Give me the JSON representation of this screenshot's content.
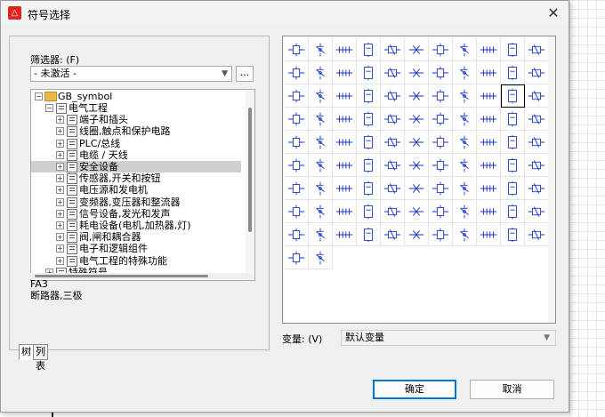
{
  "window": {
    "title": "符号选择",
    "app_icon": "app-logo-icon",
    "close_glyph": "✕"
  },
  "filter": {
    "label": "筛选器: (F)",
    "value": "- 未激活 -",
    "browse_label": "..."
  },
  "tree": {
    "root": "GB_symbol",
    "items": [
      {
        "level": 1,
        "label": "电气工程",
        "expanded": true
      },
      {
        "level": 2,
        "label": "端子和插头"
      },
      {
        "level": 2,
        "label": "线圈,触点和保护电路"
      },
      {
        "level": 2,
        "label": "PLC/总线"
      },
      {
        "level": 2,
        "label": "电缆 / 天线"
      },
      {
        "level": 2,
        "label": "安全设备",
        "selected": true
      },
      {
        "level": 2,
        "label": "传感器,开关和按钮"
      },
      {
        "level": 2,
        "label": "电压源和发电机"
      },
      {
        "level": 2,
        "label": "变频器,变压器和整流器"
      },
      {
        "level": 2,
        "label": "信号设备,发光和发声"
      },
      {
        "level": 2,
        "label": "耗电设备(电机,加热器,灯)"
      },
      {
        "level": 2,
        "label": "阀,闸和耦合器"
      },
      {
        "level": 2,
        "label": "电子和逻辑组件"
      },
      {
        "level": 2,
        "label": "电气工程的特殊功能"
      },
      {
        "level": 1,
        "label": "特殊符号"
      }
    ]
  },
  "description": {
    "code": "FA3",
    "text": "断路器,三极"
  },
  "tabs": [
    {
      "label": "树",
      "active": true
    },
    {
      "label": "列表",
      "active": false
    }
  ],
  "symbols": {
    "count": 101,
    "columns": 11,
    "selected_index": 31,
    "stroke_color": "#1a35c9"
  },
  "variant": {
    "label": "变量: (V)",
    "value": "默认变量"
  },
  "buttons": {
    "ok": "确定",
    "cancel": "取消"
  }
}
